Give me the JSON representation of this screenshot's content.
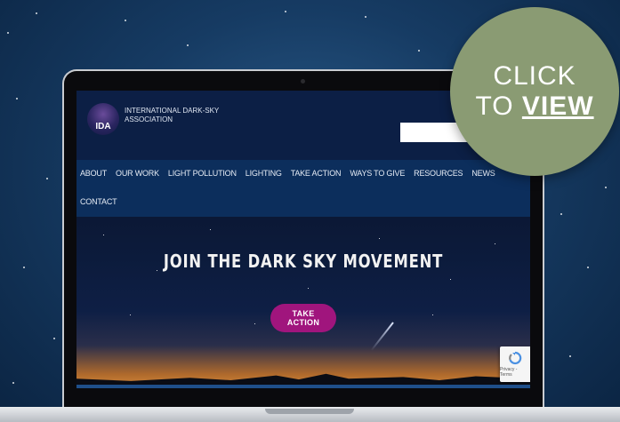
{
  "site": {
    "org_name": "INTERNATIONAL DARK-SKY ASSOCIATION",
    "logo_text": "IDA",
    "search_placeholder": "",
    "nav_row1": [
      "ABOUT",
      "OUR WORK",
      "LIGHT POLLUTION",
      "LIGHTING",
      "TAKE ACTION",
      "WAYS TO GIVE",
      "RESOURCES",
      "NEWS"
    ],
    "nav_row2": [
      "CONTACT"
    ],
    "hero_title": "JOIN THE DARK SKY MOVEMENT",
    "hero_cta": "TAKE ACTION",
    "recaptcha_label": "Privacy - Terms"
  },
  "overlay": {
    "line1": "CLICK",
    "line2_prefix": "TO ",
    "line2_emphasis": "VIEW"
  },
  "icons": {
    "logo": "ida-logo-icon",
    "recaptcha": "recaptcha-icon"
  },
  "colors": {
    "overlay_circle": "#8a9b73",
    "cta_button": "#a0157d",
    "header_bg": "#0c1f45",
    "nav_bg": "#0c2e5c"
  }
}
